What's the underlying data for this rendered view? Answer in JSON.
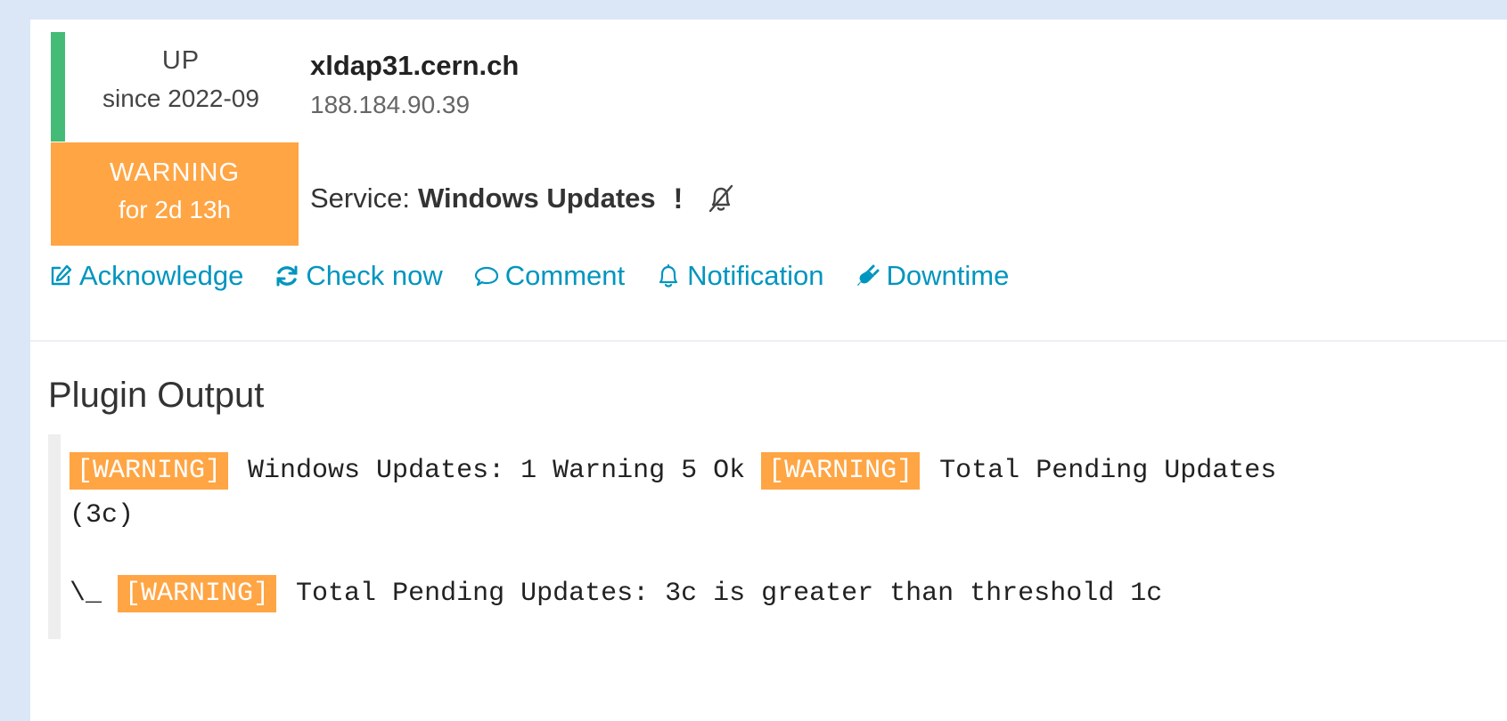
{
  "host": {
    "state": "UP",
    "since": "since 2022-09",
    "name": "xldap31.cern.ch",
    "ip": "188.184.90.39",
    "state_color": "#44bb77"
  },
  "service": {
    "state": "WARNING",
    "duration": "for 2d 13h",
    "label": "Service:",
    "name": "Windows Updates",
    "flag": "!",
    "state_color": "#ffa544",
    "notifications_icon": "bell-slash-icon"
  },
  "actions": [
    {
      "label": "Acknowledge",
      "icon": "edit-icon"
    },
    {
      "label": "Check now",
      "icon": "refresh-icon"
    },
    {
      "label": "Comment",
      "icon": "comment-icon"
    },
    {
      "label": "Notification",
      "icon": "bell-icon"
    },
    {
      "label": "Downtime",
      "icon": "plug-icon"
    }
  ],
  "plugin_output": {
    "title": "Plugin Output",
    "tag": "[WARNING]",
    "line1_a": " Windows Updates: 1 Warning 5 Ok ",
    "line1_b": " Total Pending Updates",
    "line2": "(3c)",
    "line3_prefix": "\\_ ",
    "line3_text": " Total Pending Updates: 3c is greater than threshold 1c"
  },
  "colors": {
    "link": "#0095bf",
    "background": "#dbe7f6"
  }
}
